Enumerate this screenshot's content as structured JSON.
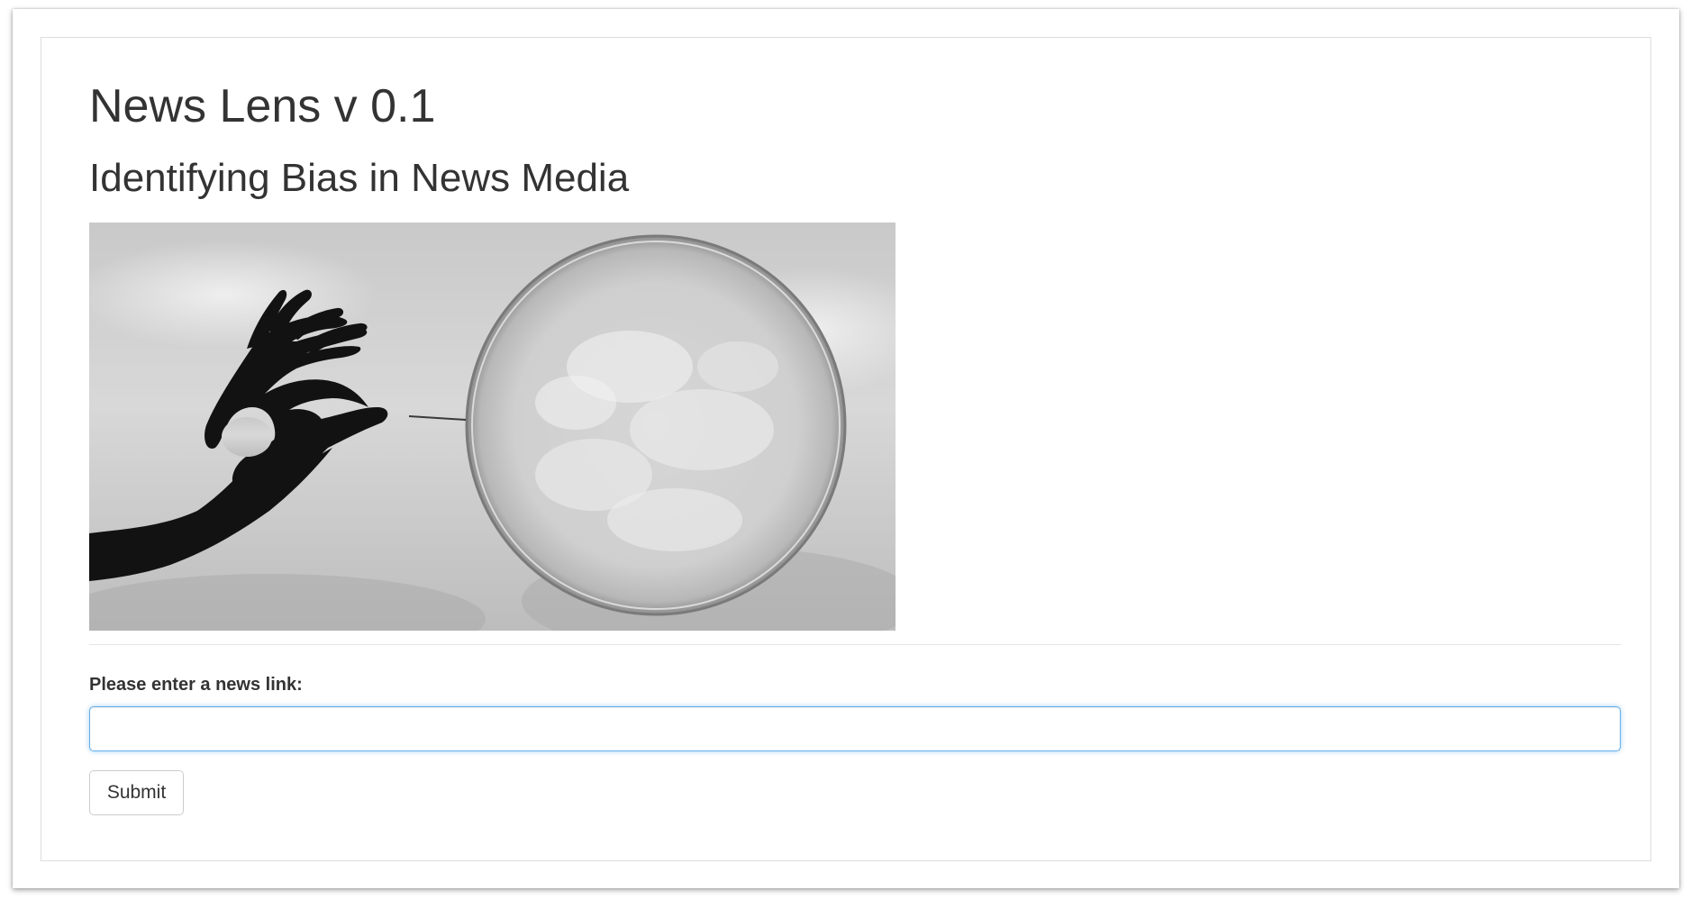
{
  "app": {
    "title": "News Lens v 0.1",
    "subtitle": "Identifying Bias in News Media"
  },
  "hero_image": {
    "alt": "Hand holding a pin about to pop a soap bubble",
    "style": "grayscale photo"
  },
  "form": {
    "label": "Please enter a news link:",
    "input_value": "",
    "input_placeholder": "",
    "submit_label": "Submit"
  },
  "colors": {
    "text": "#333333",
    "input_focus_border": "#66afe9",
    "panel_border": "#dddddd",
    "button_border": "#cccccc"
  }
}
